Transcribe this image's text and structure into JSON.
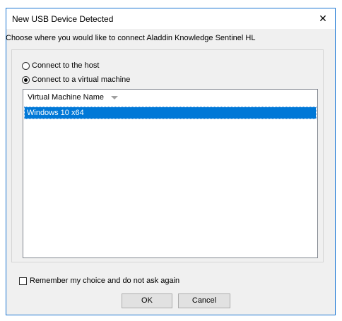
{
  "window": {
    "title": "New USB Device Detected",
    "close_glyph": "✕"
  },
  "prompt": "Choose where you would like to connect Aladdin Knowledge Sentinel HL",
  "options": {
    "host_label": "Connect to the host",
    "vm_label": "Connect to a virtual machine",
    "selected": "vm"
  },
  "vm_list": {
    "column_header": "Virtual Machine Name",
    "rows": [
      "Windows 10 x64"
    ],
    "selected_index": 0
  },
  "remember": {
    "label": "Remember my choice and do not ask again",
    "checked": false
  },
  "buttons": {
    "ok_label": "OK",
    "cancel_label": "Cancel"
  },
  "colors": {
    "selection": "#0078d7",
    "window_border": "#1a75d2",
    "dialog_bg": "#f0f0f0"
  },
  "icons": {
    "close": "close-icon",
    "sort": "sort-down-icon"
  }
}
